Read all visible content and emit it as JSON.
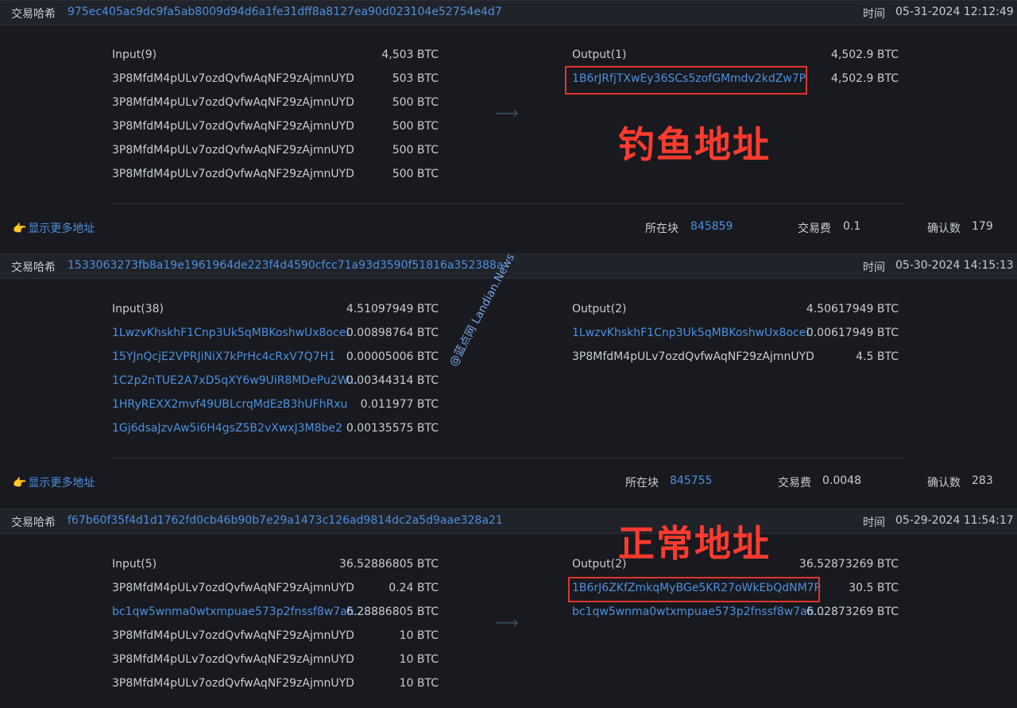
{
  "labels": {
    "hash": "交易哈希",
    "time": "时间",
    "show_more": "显示更多地址",
    "block": "所在块",
    "fee": "交易费",
    "confirmations": "确认数"
  },
  "annotations": {
    "phishing": "钓鱼地址",
    "normal": "正常地址",
    "watermark": "@蓝点网 Landian.News"
  },
  "colors": {
    "link": "#4d8fe0",
    "highlight": "#e2342a",
    "bg": "#181a1f"
  },
  "transactions": [
    {
      "hash": "975ec405ac9dc9fa5ab8009d94d6a1fe31dff8a8127ea90d023104e52754e4d7",
      "time": "05-31-2024 12:12:49",
      "input_title": "Input(9)",
      "input_total": "4,503 BTC",
      "output_title": "Output(1)",
      "output_total": "4,502.9 BTC",
      "inputs": [
        {
          "address": "3P8MfdM4pULv7ozdQvfwAqNF29zAjmnUYD",
          "amount": "503 BTC"
        },
        {
          "address": "3P8MfdM4pULv7ozdQvfwAqNF29zAjmnUYD",
          "amount": "500 BTC"
        },
        {
          "address": "3P8MfdM4pULv7ozdQvfwAqNF29zAjmnUYD",
          "amount": "500 BTC"
        },
        {
          "address": "3P8MfdM4pULv7ozdQvfwAqNF29zAjmnUYD",
          "amount": "500 BTC"
        },
        {
          "address": "3P8MfdM4pULv7ozdQvfwAqNF29zAjmnUYD",
          "amount": "500 BTC"
        }
      ],
      "outputs": [
        {
          "address": "1B6rJRfjTXwEy36SCs5zofGMmdv2kdZw7P",
          "amount": "4,502.9 BTC"
        }
      ],
      "block": "845859",
      "fee": "0.1",
      "confirmations": "179"
    },
    {
      "hash": "1533063273fb8a19e1961964de223f4d4590cfcc71a93d3590f51816a352388a",
      "time": "05-30-2024 14:15:13",
      "input_title": "Input(38)",
      "input_total": "4.51097949 BTC",
      "output_title": "Output(2)",
      "output_total": "4.50617949 BTC",
      "inputs": [
        {
          "address": "1LwzvKhskhF1Cnp3Uk5qMBKoshwUx8ocei",
          "amount": "0.00898764 BTC"
        },
        {
          "address": "15YJnQcjE2VPRJiNiX7kPrHc4cRxV7Q7H1",
          "amount": "0.00005006 BTC"
        },
        {
          "address": "1C2p2nTUE2A7xD5qXY6w9UiR8MDePu2W...",
          "amount": "0.00344314 BTC"
        },
        {
          "address": "1HRyREXX2mvf49UBLcrqMdEzB3hUFhRxu",
          "amount": "0.011977 BTC"
        },
        {
          "address": "1Gj6dsaJzvAw5i6H4gsZ5B2vXwxJ3M8be2",
          "amount": "0.00135575 BTC"
        }
      ],
      "outputs": [
        {
          "address": "1LwzvKhskhF1Cnp3Uk5qMBKoshwUx8ocei",
          "amount": "0.00617949 BTC"
        },
        {
          "address": "3P8MfdM4pULv7ozdQvfwAqNF29zAjmnUYD",
          "amount": "4.5 BTC"
        }
      ],
      "block": "845755",
      "fee": "0.0048",
      "confirmations": "283"
    },
    {
      "hash": "f67b60f35f4d1d1762fd0cb46b90b7e29a1473c126ad9814dc2a5d9aae328a21",
      "time": "05-29-2024 11:54:17",
      "input_title": "Input(5)",
      "input_total": "36.52886805 BTC",
      "output_title": "Output(2)",
      "output_total": "36.52873269 BTC",
      "inputs": [
        {
          "address": "3P8MfdM4pULv7ozdQvfwAqNF29zAjmnUYD",
          "amount": "0.24 BTC"
        },
        {
          "address": "bc1qw5wnma0wtxmpuae573p2fnssf8w7ah...",
          "amount": "6.28886805 BTC"
        },
        {
          "address": "3P8MfdM4pULv7ozdQvfwAqNF29zAjmnUYD",
          "amount": "10 BTC"
        },
        {
          "address": "3P8MfdM4pULv7ozdQvfwAqNF29zAjmnUYD",
          "amount": "10 BTC"
        },
        {
          "address": "3P8MfdM4pULv7ozdQvfwAqNF29zAjmnUYD",
          "amount": "10 BTC"
        }
      ],
      "outputs": [
        {
          "address": "1B6rJ6ZKfZmkqMyBGe5KR27oWkEbQdNM7P",
          "amount": "30.5 BTC"
        },
        {
          "address": "bc1qw5wnma0wtxmpuae573p2fnssf8w7ah...",
          "amount": "6.02873269 BTC"
        }
      ]
    }
  ]
}
